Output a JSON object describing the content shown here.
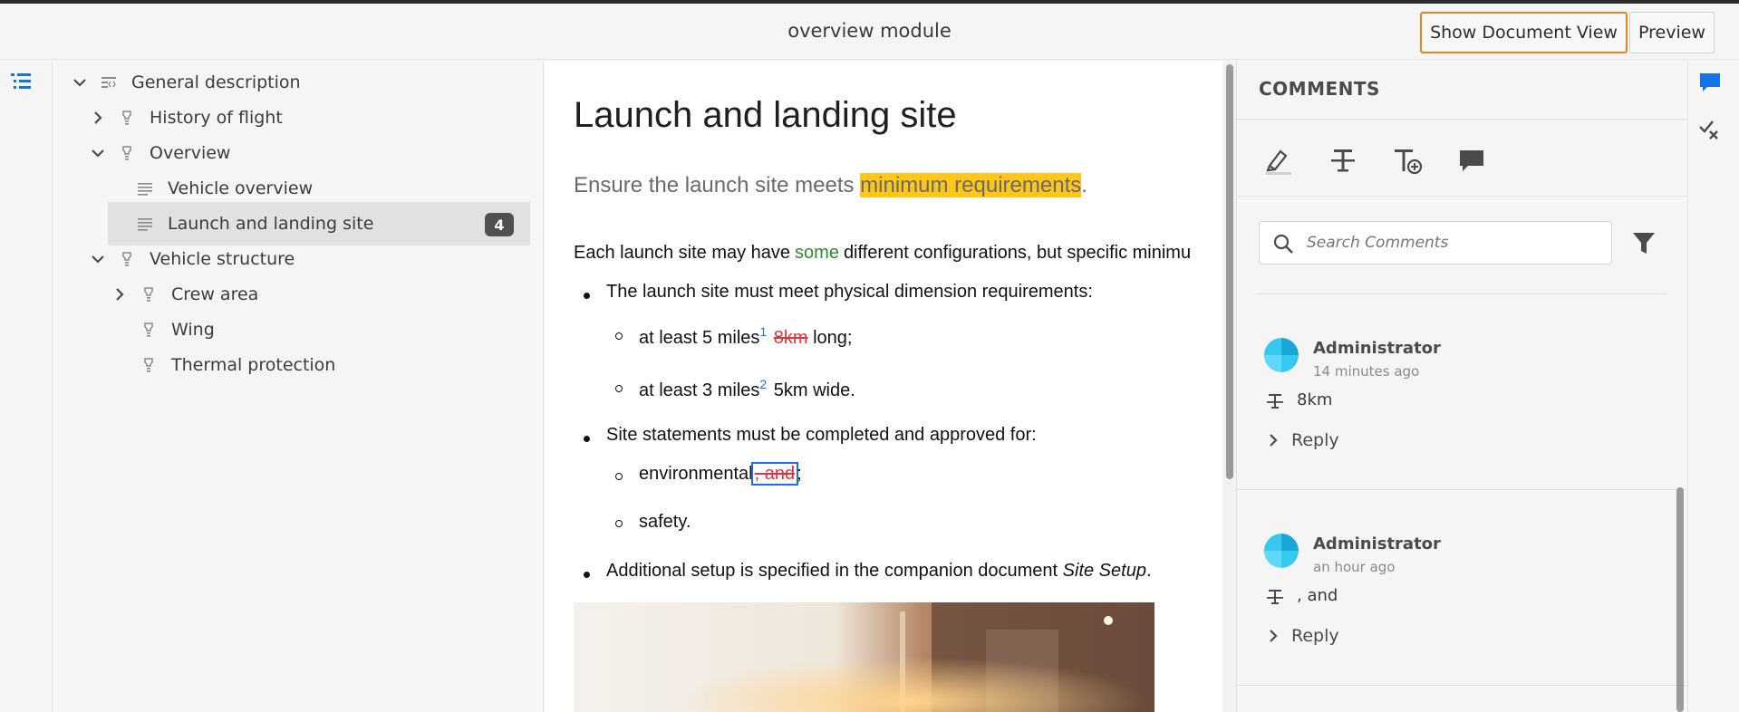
{
  "header": {
    "title": "overview module",
    "show_document_view_label": "Show Document View",
    "preview_label": "Preview"
  },
  "tree": {
    "items": [
      {
        "label": "General description",
        "expanded": true
      },
      {
        "label": "History of flight",
        "expanded": false
      },
      {
        "label": "Overview",
        "expanded": true
      },
      {
        "label": "Vehicle overview"
      },
      {
        "label": "Launch and landing site",
        "selected": true,
        "badge": "4"
      },
      {
        "label": "Vehicle structure",
        "expanded": true
      },
      {
        "label": "Crew area",
        "expanded": false
      },
      {
        "label": "Wing"
      },
      {
        "label": "Thermal protection"
      }
    ]
  },
  "document": {
    "title": "Launch and landing site",
    "shortdesc_before": "Ensure the launch site meets ",
    "shortdesc_highlight": "minimum requirements",
    "shortdesc_after": ".",
    "para_before": "Each launch site may have",
    "para_insert": "some",
    "para_after": "different configurations, but specific minimu",
    "bullet1": "The launch site must meet physical dimension requirements:",
    "sub1_text": "at least 5 miles",
    "sub1_fn": "1",
    "sub1_del": "8km",
    "sub1_after": " long;",
    "sub2_text": "at least 3 miles",
    "sub2_fn": "2",
    "sub2_after": " 5km wide.",
    "bullet2": "Site statements must be completed and approved for:",
    "sub3_text": "environmental",
    "sub3_del": ", and",
    "sub3_after": ";",
    "sub4_text": "safety.",
    "bullet3_before": "Additional setup is specified in the companion document ",
    "bullet3_italic": "Site Setup",
    "bullet3_after": "."
  },
  "comments": {
    "title": "COMMENTS",
    "search_placeholder": "Search Comments",
    "items": [
      {
        "author": "Administrator",
        "time": "14 minutes ago",
        "text": "8km",
        "reply": "Reply"
      },
      {
        "author": "Administrator",
        "time": "an hour ago",
        "text": ", and",
        "reply": "Reply"
      }
    ]
  },
  "colors": {
    "accent": "#1473e6",
    "highlight": "#ffc71a",
    "focus_border": "#e68619",
    "deletion": "#d7373f",
    "insertion": "#2e8b2e"
  }
}
